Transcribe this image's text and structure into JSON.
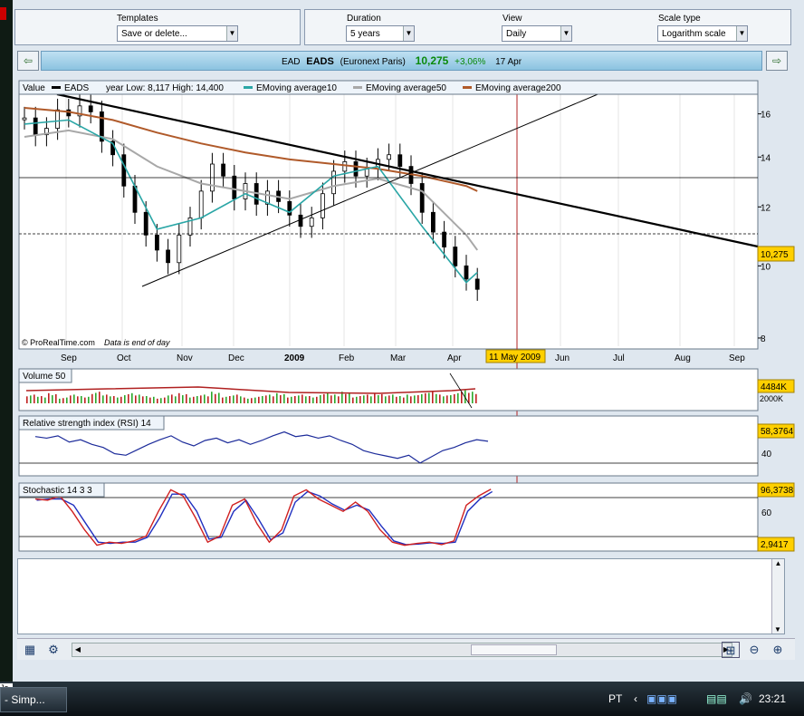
{
  "toolbar": {
    "templates": {
      "label": "Templates",
      "value": "Save or delete..."
    },
    "duration": {
      "label": "Duration",
      "value": "5 years"
    },
    "view": {
      "label": "View",
      "value": "Daily"
    },
    "scale": {
      "label": "Scale type",
      "value": "Logarithm scale"
    }
  },
  "title": {
    "ticker": "EAD",
    "name": "EADS",
    "exchange": "(Euronext Paris)",
    "price": "10,275",
    "change": "+3,06%",
    "date": "17 Apr"
  },
  "main": {
    "legend_value": "Value",
    "legend_eads": "EADS",
    "legend_range": "year Low: 8,117 High: 14,400",
    "legend_ema10": "EMoving average10",
    "legend_ema50": "EMoving average50",
    "legend_ema200": "EMoving average200",
    "credit": "© ProRealTime.com",
    "credit_note": "Data is end of day",
    "price_tag": "10,275",
    "cursor_date": "11 May 2009"
  },
  "volume": {
    "label": "Volume 50",
    "tag": "4484K"
  },
  "rsi": {
    "label": "Relative strength index (RSI) 14",
    "tag": "58,3764"
  },
  "stoch": {
    "label": "Stochastic 14 3 3",
    "tag_high": "96,3738",
    "tag_low": "2,9417"
  },
  "taskbar": {
    "task": "- Simp...",
    "side_label": "Ja",
    "lang": "PT",
    "time": "23:21"
  },
  "colors": {
    "ema10": "#2aa6a6",
    "ema50": "#a8a8a8",
    "ema200": "#b05a2a",
    "rsi": "#1c2b9a",
    "stoch_k": "#d02020",
    "stoch_d": "#2030c0",
    "cursor": "#b02020"
  },
  "chart_data": [
    {
      "type": "line",
      "title": "EADS",
      "y_axis_ticks": [
        16,
        14,
        12,
        10,
        8
      ],
      "x_axis_ticks": [
        "Sep",
        "Oct",
        "Nov",
        "Dec",
        "2009",
        "Feb",
        "Mar",
        "Apr",
        "Jun",
        "Jul",
        "Aug",
        "Sep"
      ],
      "ylim": [
        7.8,
        17
      ],
      "scale": "log",
      "series": [
        {
          "name": "EADS",
          "type": "candlestick",
          "x": [
            0,
            4,
            8,
            12,
            16,
            20,
            24,
            28,
            32,
            36,
            40,
            44,
            48,
            52,
            56,
            60,
            64,
            68,
            72,
            76,
            80,
            84,
            88,
            92,
            96,
            100,
            104,
            108,
            112,
            116,
            120,
            124,
            128,
            132,
            136,
            140,
            144,
            148,
            152,
            156,
            160,
            164
          ],
          "values": [
            15.8,
            15.0,
            15.3,
            16.2,
            15.9,
            16.4,
            16.1,
            14.7,
            14.1,
            12.8,
            11.8,
            11.0,
            10.5,
            10.1,
            11.0,
            11.6,
            12.6,
            13.7,
            13.2,
            12.3,
            12.9,
            12.1,
            12.6,
            12.2,
            11.7,
            11.3,
            11.6,
            12.5,
            13.4,
            13.8,
            13.2,
            13.5,
            13.9,
            14.1,
            13.6,
            12.9,
            11.8,
            11.1,
            10.6,
            10.0,
            9.6,
            9.3
          ]
        },
        {
          "name": "EMoving average10",
          "x": [
            0,
            16,
            32,
            48,
            64,
            80,
            96,
            112,
            128,
            144,
            160,
            164
          ],
          "values": [
            15.5,
            15.7,
            14.6,
            11.2,
            11.6,
            12.5,
            11.8,
            13.2,
            13.6,
            11.3,
            9.5,
            9.8
          ]
        },
        {
          "name": "EMoving average50",
          "x": [
            0,
            16,
            32,
            48,
            64,
            80,
            96,
            112,
            128,
            144,
            160,
            164
          ],
          "values": [
            14.9,
            15.2,
            14.8,
            13.6,
            12.9,
            12.6,
            12.3,
            12.8,
            13.1,
            12.6,
            11.0,
            10.5
          ]
        },
        {
          "name": "EMoving average200",
          "x": [
            0,
            16,
            32,
            48,
            64,
            80,
            96,
            112,
            128,
            144,
            160,
            164
          ],
          "values": [
            16.3,
            16.1,
            15.7,
            15.1,
            14.6,
            14.2,
            13.9,
            13.7,
            13.5,
            13.2,
            12.8,
            12.6
          ]
        }
      ]
    },
    {
      "type": "bar",
      "title": "Volume 50",
      "y_axis_ticks": [
        "2000K"
      ],
      "series": [
        {
          "name": "Volume",
          "values": [
            0.6,
            0.5,
            0.7,
            0.4,
            0.6,
            0.5,
            0.8,
            0.6,
            0.5,
            0.7,
            0.6,
            0.5,
            0.4,
            0.6,
            0.7,
            0.5,
            0.6,
            0.8,
            0.5,
            0.6,
            0.4,
            0.5,
            0.6,
            0.7,
            0.5,
            0.6,
            0.5,
            0.7,
            0.6,
            0.8,
            0.5,
            0.6,
            0.7,
            0.6,
            0.5,
            0.6,
            0.7,
            0.8,
            0.6,
            0.7,
            0.9,
            0.8
          ]
        }
      ]
    },
    {
      "type": "line",
      "title": "Relative strength index (RSI) 14",
      "y_axis_ticks": [
        40
      ],
      "ylim": [
        15,
        85
      ],
      "series": [
        {
          "name": "RSI",
          "values": [
            62,
            60,
            63,
            55,
            58,
            52,
            48,
            40,
            38,
            45,
            52,
            58,
            63,
            55,
            50,
            57,
            60,
            54,
            58,
            52,
            57,
            63,
            68,
            62,
            64,
            60,
            63,
            57,
            52,
            44,
            40,
            37,
            34,
            38,
            28,
            36,
            44,
            48,
            54,
            58,
            56
          ]
        }
      ]
    },
    {
      "type": "line",
      "title": "Stochastic 14 3 3",
      "y_axis_ticks": [
        60
      ],
      "ylim": [
        0,
        100
      ],
      "series": [
        {
          "name": "%K",
          "values": [
            80,
            78,
            85,
            60,
            30,
            5,
            10,
            8,
            12,
            20,
            60,
            95,
            85,
            50,
            10,
            20,
            70,
            80,
            40,
            10,
            30,
            85,
            95,
            80,
            70,
            60,
            75,
            60,
            30,
            10,
            5,
            8,
            10,
            6,
            12,
            70,
            85,
            96
          ]
        },
        {
          "name": "%D",
          "values": [
            78,
            80,
            80,
            70,
            40,
            10,
            8,
            10,
            10,
            18,
            50,
            88,
            88,
            60,
            15,
            18,
            60,
            78,
            48,
            14,
            25,
            75,
            92,
            85,
            72,
            62,
            70,
            62,
            36,
            12,
            6,
            7,
            9,
            8,
            10,
            60,
            80,
            92
          ]
        }
      ]
    }
  ]
}
